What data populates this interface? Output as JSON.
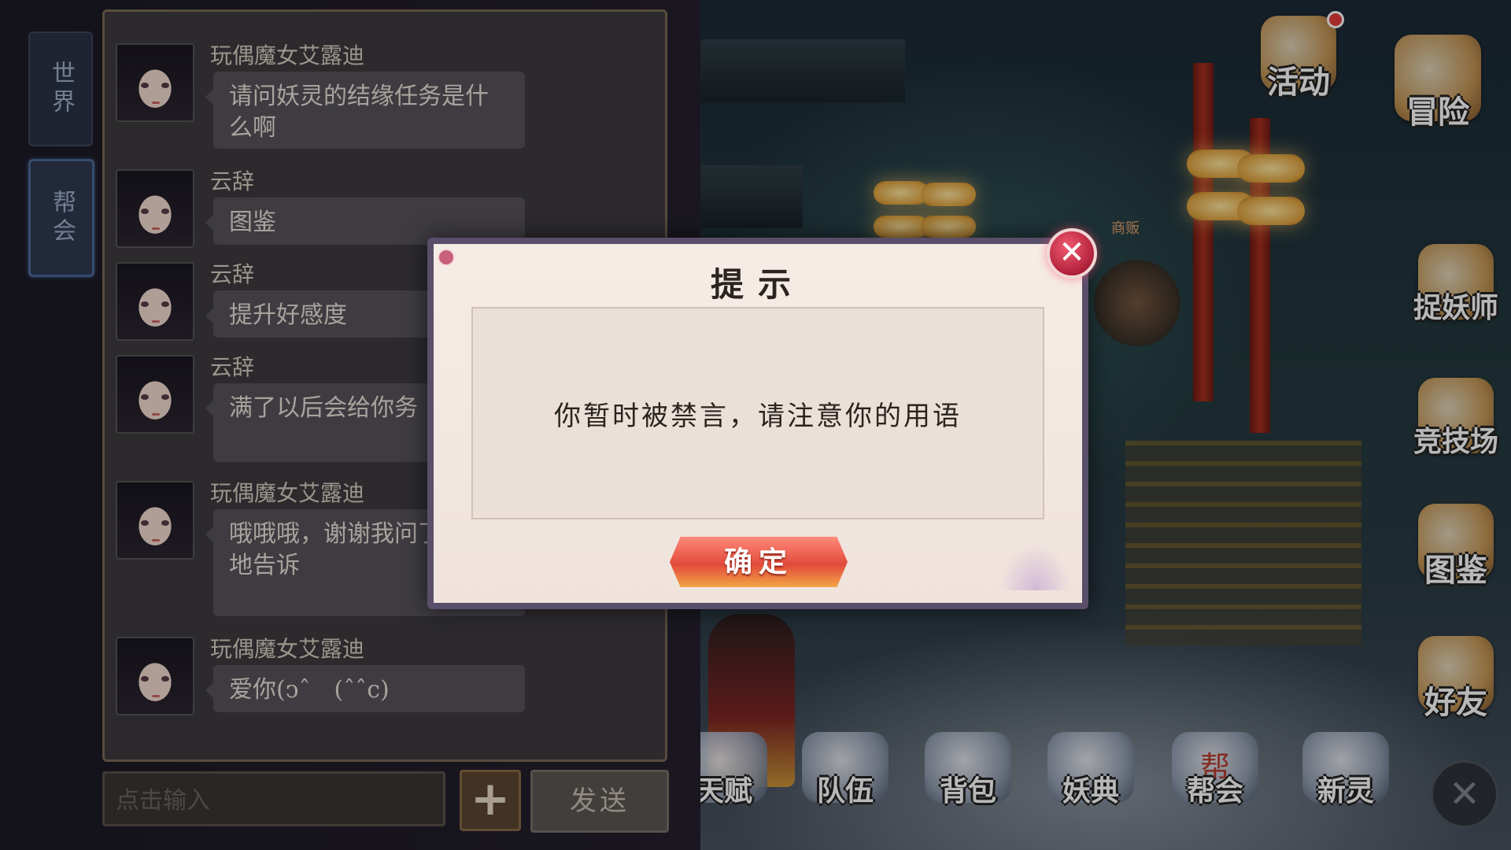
{
  "chat": {
    "tabs": {
      "world": "世界",
      "guild": "帮会"
    },
    "messages": [
      {
        "sender": "玩偶魔女艾露迪",
        "text": "请问妖灵的结缘任务是什么啊"
      },
      {
        "sender": "云辞",
        "text": "图鉴"
      },
      {
        "sender": "云辞",
        "text": "提升好感度"
      },
      {
        "sender": "云辞",
        "text": "满了以后会给你务"
      },
      {
        "sender": "玩偶魔女艾露迪",
        "text": "哦哦哦，谢谢我问了好多地告诉"
      },
      {
        "sender": "玩偶魔女艾露迪",
        "text": "爱你(ↄˆ　(ˆˆc)"
      }
    ],
    "input_placeholder": "点击输入",
    "plus_label": "+",
    "send_label": "发送"
  },
  "side_menu": [
    {
      "label": "活动",
      "icon": "lantern-icon",
      "badge": true
    },
    {
      "label": "冒险",
      "icon": "scroll-icon",
      "badge": false
    },
    {
      "label": "捉妖师",
      "icon": "fox-mask-icon",
      "badge": false
    },
    {
      "label": "竞技场",
      "icon": "boxing-glove-icon",
      "badge": false
    },
    {
      "label": "图鉴",
      "icon": "book-scroll-icon",
      "badge": false
    },
    {
      "label": "好友",
      "icon": "friend-icon",
      "badge": false
    }
  ],
  "bottom_menu": [
    {
      "label": "天赋",
      "icon": "talent-icon"
    },
    {
      "label": "队伍",
      "icon": "team-icon"
    },
    {
      "label": "背包",
      "icon": "bag-icon"
    },
    {
      "label": "妖典",
      "icon": "demon-book-icon"
    },
    {
      "label": "帮会",
      "icon": "guild-icon",
      "glyph": "帮"
    },
    {
      "label": "新灵",
      "icon": "spirit-icon"
    }
  ],
  "npc_label": "商贩",
  "dialog": {
    "title": "提示",
    "message": "你暂时被禁言，请注意你的用语",
    "confirm_label": "确定",
    "close_glyph": "✕"
  },
  "colors": {
    "dialog_bg": "#f6ece6",
    "confirm_red": "#e24a3c",
    "close_red": "#b0203a",
    "chat_panel": "#3d3b3f"
  }
}
